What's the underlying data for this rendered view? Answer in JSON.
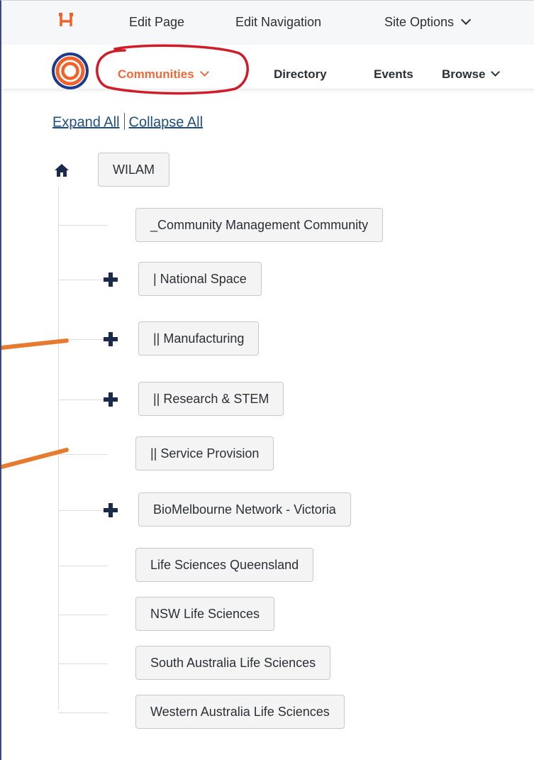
{
  "admin_bar": {
    "logo_icon": "hl-logo-icon",
    "edit_page": "Edit Page",
    "edit_navigation": "Edit Navigation",
    "site_options": "Site Options"
  },
  "main_nav": {
    "logo_icon": "concentric-circles-logo",
    "items": [
      {
        "label": "Communities"
      },
      {
        "label": "Directory"
      },
      {
        "label": "Events"
      },
      {
        "label": "Browse"
      }
    ]
  },
  "tree_controls": {
    "expand_all": "Expand All",
    "collapse_all": "Collapse All"
  },
  "tree": {
    "root": "WILAM",
    "nodes": [
      {
        "label": "_Community Management Community"
      },
      {
        "label": "| National Space"
      },
      {
        "label": "|| Manufacturing"
      },
      {
        "label": "|| Research & STEM"
      },
      {
        "label": "|| Service Provision"
      },
      {
        "label": "BioMelbourne Network - Victoria"
      },
      {
        "label": "Life Sciences Queensland"
      },
      {
        "label": "NSW Life Sciences"
      },
      {
        "label": "South Australia Life Sciences"
      },
      {
        "label": "Western Australia Life Sciences"
      }
    ]
  },
  "colors": {
    "accent": "#ef6a3a",
    "annotation_red": "#d01c28",
    "annotation_orange": "#e67a2e",
    "icon_navy": "#1b2a4a"
  }
}
